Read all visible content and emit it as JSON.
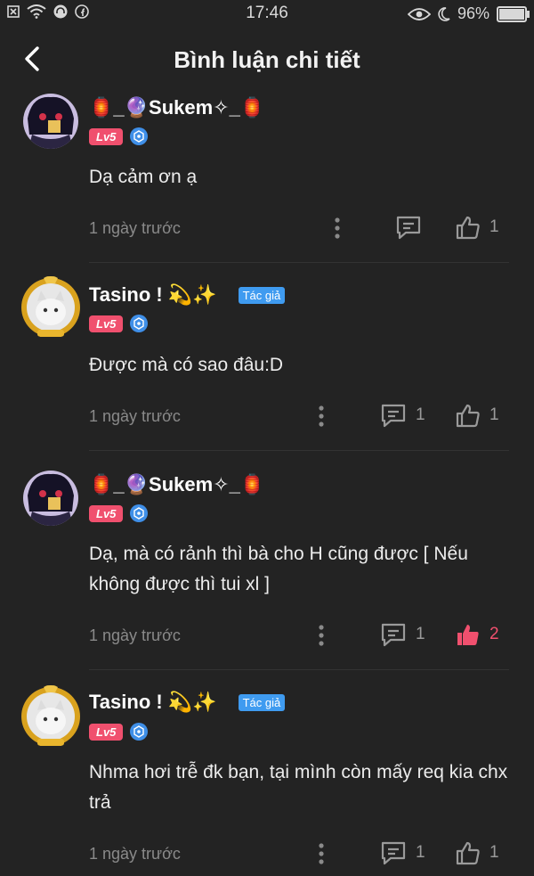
{
  "status_bar": {
    "time": "17:46",
    "battery": "96%"
  },
  "header": {
    "title": "Bình luận chi tiết"
  },
  "comments": [
    {
      "user": "🏮_🔮Sukem✧_🏮",
      "level": "Lv5",
      "text": "Dạ cảm ơn ạ",
      "time": "1 ngày trước",
      "reply_count": "",
      "like_count": "1",
      "liked": false,
      "is_author": false
    },
    {
      "user": "Tasino ! 💫✨",
      "author_tag": "Tác giả",
      "level": "Lv5",
      "text": "Được mà có sao đâu:D",
      "time": "1 ngày trước",
      "reply_count": "1",
      "like_count": "1",
      "liked": false,
      "is_author": true
    },
    {
      "user": "🏮_🔮Sukem✧_🏮",
      "level": "Lv5",
      "text": "Dạ, mà có rảnh thì bà cho H cũng được [ Nếu không được thì tui xl ]",
      "time": "1 ngày trước",
      "reply_count": "1",
      "like_count": "2",
      "liked": true,
      "is_author": false
    },
    {
      "user": "Tasino ! 💫✨",
      "author_tag": "Tác giả",
      "level": "Lv5",
      "text": "Nhma hơi trễ đk bạn, tại mình còn mấy req kia chx trả",
      "time": "1 ngày trước",
      "reply_count": "1",
      "like_count": "1",
      "liked": false,
      "is_author": true
    }
  ],
  "colors": {
    "background": "#232323",
    "accent": "#f0506e",
    "author_tag": "#3f9bf0"
  }
}
